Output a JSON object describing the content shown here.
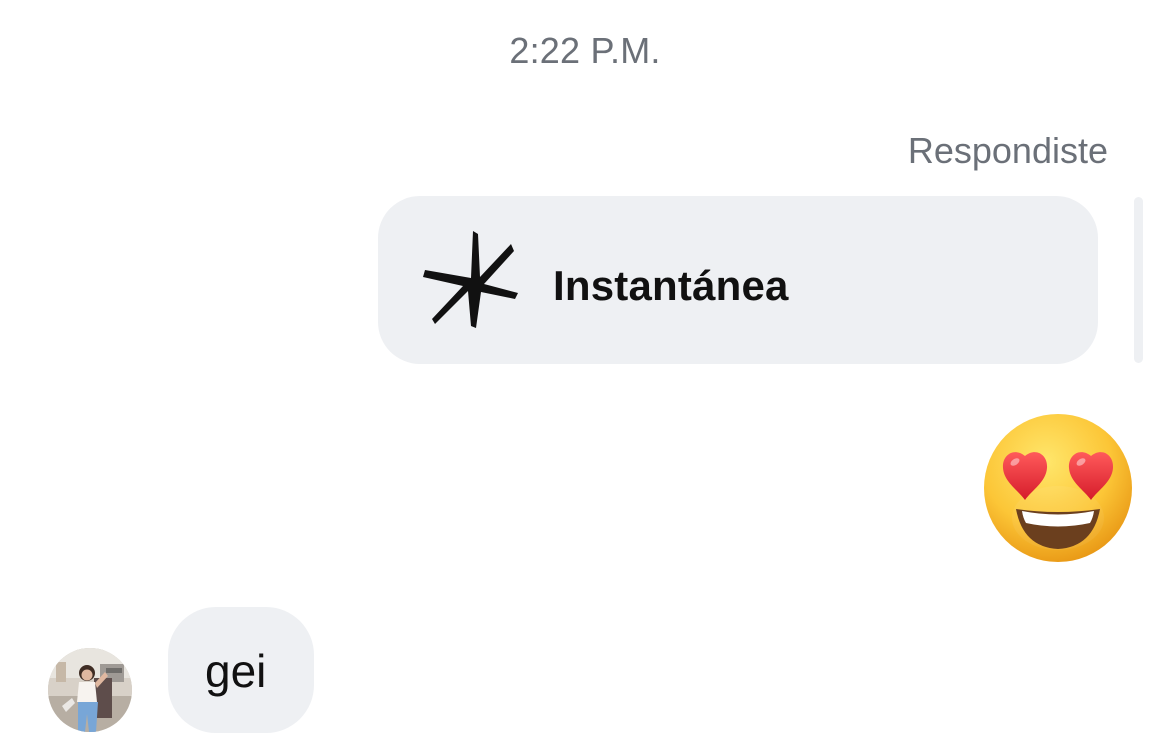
{
  "chat": {
    "timestamp": "2:22 P.M.",
    "reply_label": "Respondiste",
    "snap_message": {
      "label": "Instantánea",
      "icon": "sparkle-snap-icon"
    },
    "reaction_emoji": {
      "icon": "smiling-face-with-heart-eyes-emoji"
    },
    "incoming_message": {
      "text": "gei",
      "avatar": "profile-avatar"
    }
  },
  "colors": {
    "bubble_background": "#eef0f3",
    "secondary_text": "#6b7078",
    "primary_text": "#111111",
    "icon": "#111111"
  }
}
